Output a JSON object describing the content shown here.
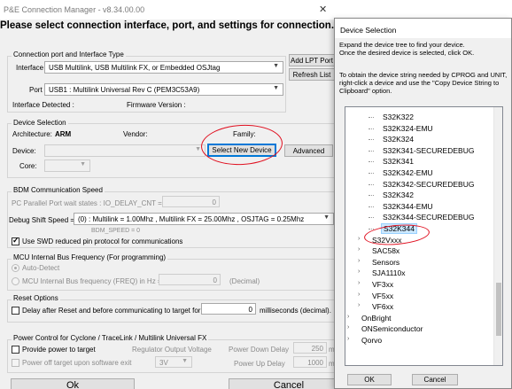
{
  "window": {
    "title": "P&E Connection Manager - v8.34.00.00"
  },
  "headline": "Please select connection interface, port, and settings for connection.",
  "connection": {
    "group_title": "Connection port and Interface Type",
    "interface_label": "Interface :",
    "interface_value": "USB Multilink, USB Multilink FX, or Embedded OSJtag",
    "port_label": "Port :",
    "port_value": "USB1 : Multilink Universal Rev C (PEM3C53A9)",
    "detected_label": "Interface Detected :",
    "firmware_label": "Firmware Version :",
    "add_lpt_label": "Add LPT Port",
    "refresh_label": "Refresh List"
  },
  "device": {
    "group_title": "Device Selection",
    "arch_label": "Architecture:",
    "arch_value": "ARM",
    "vendor_label": "Vendor:",
    "family_label": "Family:",
    "device_label": "Device:",
    "core_label": "Core:",
    "select_new_label": "Select New Device",
    "advanced_label": "Advanced"
  },
  "bdm": {
    "group_title": "BDM Communication Speed",
    "pc_parallel_label": "PC Parallel Port wait states : IO_DELAY_CNT =",
    "pc_parallel_value": "0",
    "debug_shift_label": "Debug Shift Speed =",
    "debug_shift_value": "(0) : Multilink = 1.00Mhz , Multilink FX = 25.00Mhz , OSJTAG = 0.25Mhz",
    "bdm_speed_text": "BDM_SPEED = 0",
    "swd_label": "Use SWD reduced pin protocol for communications"
  },
  "mcu": {
    "group_title": "MCU Internal Bus Frequency (For programming)",
    "auto_label": "Auto-Detect",
    "freq_label": "MCU Internal Bus frequency (FREQ) in Hz =",
    "freq_value": "0",
    "decimal_label": "(Decimal)"
  },
  "reset": {
    "group_title": "Reset Options",
    "delay_label": "Delay after Reset and before communicating to target for",
    "delay_value": "0",
    "ms_label": "milliseconds (decimal)."
  },
  "power": {
    "group_title": "Power Control for Cyclone / TraceLink / Multilink Universal FX",
    "provide_label": "Provide power to target",
    "reg_label": "Regulator Output Voltage",
    "power_down_label": "Power Down Delay",
    "power_down_value": "250",
    "power_off_label": "Power off target upon software exit",
    "voltage_value": "3V",
    "power_up_label": "Power Up Delay",
    "power_up_value": "1000",
    "unit_cut_1": "m",
    "unit_cut_2": "m"
  },
  "buttons": {
    "ok": "Ok",
    "cancel": "Cancel"
  },
  "device_dialog": {
    "title": "Device Selection",
    "desc1": "Expand the device tree to find your device.",
    "desc2": "Once the desired device is selected, click OK.",
    "desc3": "To obtain the device string needed by CPROG and UNIT, right-click a device and use the \"Copy Device String to Clipboard\" option.",
    "tree_items": [
      {
        "label": "S32K322",
        "level": 2,
        "chevron": ""
      },
      {
        "label": "S32K324-EMU",
        "level": 2,
        "chevron": ""
      },
      {
        "label": "S32K324",
        "level": 2,
        "chevron": ""
      },
      {
        "label": "S32K341-SECUREDEBUG",
        "level": 2,
        "chevron": ""
      },
      {
        "label": "S32K341",
        "level": 2,
        "chevron": ""
      },
      {
        "label": "S32K342-EMU",
        "level": 2,
        "chevron": ""
      },
      {
        "label": "S32K342-SECUREDEBUG",
        "level": 2,
        "chevron": ""
      },
      {
        "label": "S32K342",
        "level": 2,
        "chevron": ""
      },
      {
        "label": "S32K344-EMU",
        "level": 2,
        "chevron": ""
      },
      {
        "label": "S32K344-SECUREDEBUG",
        "level": 2,
        "chevron": ""
      },
      {
        "label": "S32K344",
        "level": 2,
        "chevron": "",
        "selected": true
      },
      {
        "label": "S32Vxxx",
        "level": 1,
        "chevron": "›"
      },
      {
        "label": "SAC58x",
        "level": 1,
        "chevron": "›"
      },
      {
        "label": "Sensors",
        "level": 1,
        "chevron": "›"
      },
      {
        "label": "SJA1110x",
        "level": 1,
        "chevron": "›"
      },
      {
        "label": "VF3xx",
        "level": 1,
        "chevron": "›"
      },
      {
        "label": "VF5xx",
        "level": 1,
        "chevron": "›"
      },
      {
        "label": "VF6xx",
        "level": 1,
        "chevron": "›"
      },
      {
        "label": "OnBright",
        "level": 0,
        "chevron": "›"
      },
      {
        "label": "ONSemiconductor",
        "level": 0,
        "chevron": "›"
      },
      {
        "label": "Qorvo",
        "level": 0,
        "chevron": "›"
      }
    ],
    "ok_label": "OK",
    "cancel_label": "Cancel"
  },
  "colors": {
    "selection": "#cce8ff",
    "annotation": "#e01020",
    "focus": "#0078d7"
  }
}
